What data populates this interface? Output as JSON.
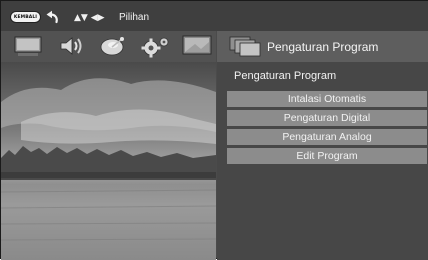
{
  "header": {
    "back_button": "KEMBALI",
    "nav_glyphs": "▲▼ ◀▶",
    "hint": "Pilihan"
  },
  "menu_icons": [
    "tv-icon",
    "speaker-icon",
    "satellite-dish-icon",
    "settings-gear-icon",
    "monitor-icon"
  ],
  "panel": {
    "title": "Pengaturan Program",
    "subtitle": "Pengaturan Program",
    "items": [
      {
        "label": "Intalasi Otomatis"
      },
      {
        "label": "Pengaturan Digital"
      },
      {
        "label": "Pengaturan Analog"
      },
      {
        "label": "Edit Program"
      }
    ]
  },
  "colors": {
    "background": "#4b4b4b",
    "panel_header": "#5e5e5e",
    "menu_item": "#8c8c8c",
    "text": "#f2f2f2"
  }
}
